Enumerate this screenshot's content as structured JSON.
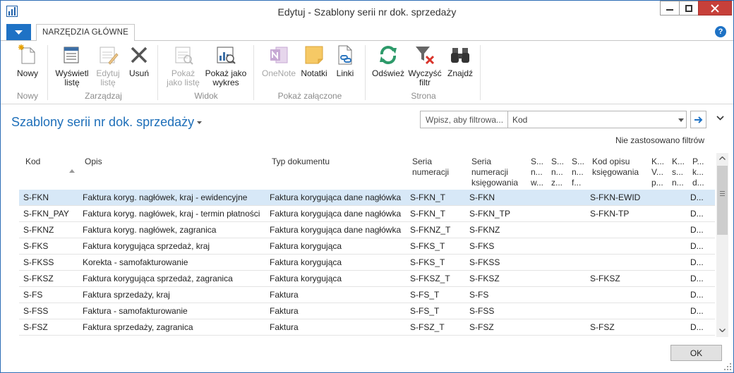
{
  "window": {
    "title": "Edytuj - Szablony serii nr dok. sprzedaży"
  },
  "ribbon": {
    "tab": "NARZĘDZIA GŁÓWNE",
    "groups": [
      {
        "label": "Nowy",
        "buttons": [
          {
            "label": "Nowy",
            "icon": "new-icon",
            "enabled": true
          }
        ]
      },
      {
        "label": "Zarządzaj",
        "buttons": [
          {
            "label1": "Wyświetl",
            "label2": "listę",
            "icon": "view-list-icon",
            "enabled": true
          },
          {
            "label1": "Edytuj",
            "label2": "listę",
            "icon": "edit-list-icon",
            "enabled": false
          },
          {
            "label1": "Usuń",
            "label2": "",
            "icon": "delete-icon",
            "enabled": true
          }
        ]
      },
      {
        "label": "Widok",
        "buttons": [
          {
            "label1": "Pokaż",
            "label2": "jako listę",
            "icon": "show-as-list-icon",
            "enabled": false
          },
          {
            "label1": "Pokaż jako",
            "label2": "wykres",
            "icon": "show-as-chart-icon",
            "enabled": true
          }
        ]
      },
      {
        "label": "Pokaż załączone",
        "buttons": [
          {
            "label1": "OneNote",
            "label2": "",
            "icon": "onenote-icon",
            "enabled": false
          },
          {
            "label1": "Notatki",
            "label2": "",
            "icon": "notes-icon",
            "enabled": true
          },
          {
            "label1": "Linki",
            "label2": "",
            "icon": "links-icon",
            "enabled": true
          }
        ]
      },
      {
        "label": "Strona",
        "buttons": [
          {
            "label1": "Odśwież",
            "label2": "",
            "icon": "refresh-icon",
            "enabled": true
          },
          {
            "label1": "Wyczyść",
            "label2": "filtr",
            "icon": "clear-filter-icon",
            "enabled": true
          },
          {
            "label1": "Znajdź",
            "label2": "",
            "icon": "find-icon",
            "enabled": true
          }
        ]
      }
    ]
  },
  "page": {
    "title": "Szablony serii nr dok. sprzedaży",
    "filter_placeholder": "Wpisz, aby filtrowa...",
    "filter_field": "Kod",
    "filter_status": "Nie zastosowano filtrów"
  },
  "grid": {
    "headers": {
      "kod": "Kod",
      "opis": "Opis",
      "typ": "Typ dokumentu",
      "seria_num_1": "Seria",
      "seria_num_2": "numeracji",
      "seria_ksieg_1": "Seria",
      "seria_ksieg_2": "numeracji",
      "seria_ksieg_3": "księgowania",
      "s1_1": "S...",
      "s1_2": "n...",
      "s1_3": "w...",
      "s2_1": "S...",
      "s2_2": "n...",
      "s2_3": "z...",
      "s3_1": "S...",
      "s3_2": "n...",
      "s3_3": "f...",
      "kod_opisu_1": "Kod opisu",
      "kod_opisu_2": "księgowania",
      "k1_1": "K...",
      "k1_2": "V...",
      "k1_3": "p...",
      "k2_1": "K...",
      "k2_2": "s...",
      "k2_3": "n...",
      "p_1": "P...",
      "p_2": "k...",
      "p_3": "d..."
    },
    "rows": [
      {
        "kod": "S-FKN",
        "opis": "Faktura koryg. nagłówek, kraj - ewidencyjne",
        "typ": "Faktura korygująca dane nagłówka",
        "seria_num": "S-FKN_T",
        "seria_ksieg": "S-FKN",
        "kod_opisu": "S-FKN-EWID",
        "p": "D..."
      },
      {
        "kod": "S-FKN_PAY",
        "opis": "Faktura koryg. nagłówek, kraj - termin płatności",
        "typ": "Faktura korygująca dane nagłówka",
        "seria_num": "S-FKN_T",
        "seria_ksieg": "S-FKN_TP",
        "kod_opisu": "S-FKN-TP",
        "p": "D..."
      },
      {
        "kod": "S-FKNZ",
        "opis": "Faktura koryg. nagłówek, zagranica",
        "typ": "Faktura korygująca dane nagłówka",
        "seria_num": "S-FKNZ_T",
        "seria_ksieg": "S-FKNZ",
        "kod_opisu": "",
        "p": "D..."
      },
      {
        "kod": "S-FKS",
        "opis": "Faktura korygująca sprzedaż, kraj",
        "typ": "Faktura korygująca",
        "seria_num": "S-FKS_T",
        "seria_ksieg": "S-FKS",
        "kod_opisu": "",
        "p": "D..."
      },
      {
        "kod": "S-FKSS",
        "opis": "Korekta - samofakturowanie",
        "typ": "Faktura korygująca",
        "seria_num": "S-FKS_T",
        "seria_ksieg": "S-FKSS",
        "kod_opisu": "",
        "p": "D..."
      },
      {
        "kod": "S-FKSZ",
        "opis": "Faktura korygująca sprzedaż, zagranica",
        "typ": "Faktura korygująca",
        "seria_num": "S-FKSZ_T",
        "seria_ksieg": "S-FKSZ",
        "kod_opisu": "S-FKSZ",
        "p": "D..."
      },
      {
        "kod": "S-FS",
        "opis": "Faktura sprzedaży, kraj",
        "typ": "Faktura",
        "seria_num": "S-FS_T",
        "seria_ksieg": "S-FS",
        "kod_opisu": "",
        "p": "D..."
      },
      {
        "kod": "S-FSS",
        "opis": "Faktura - samofakturowanie",
        "typ": "Faktura",
        "seria_num": "S-FS_T",
        "seria_ksieg": "S-FSS",
        "kod_opisu": "",
        "p": "D..."
      },
      {
        "kod": "S-FSZ",
        "opis": "Faktura sprzedaży, zagranica",
        "typ": "Faktura",
        "seria_num": "S-FSZ_T",
        "seria_ksieg": "S-FSZ",
        "kod_opisu": "S-FSZ",
        "p": "D..."
      }
    ],
    "selected_row": 0
  },
  "footer": {
    "ok_label": "OK"
  },
  "colors": {
    "accent": "#1e72c5",
    "selection": "#d7e8f7",
    "close": "#c7403a"
  }
}
